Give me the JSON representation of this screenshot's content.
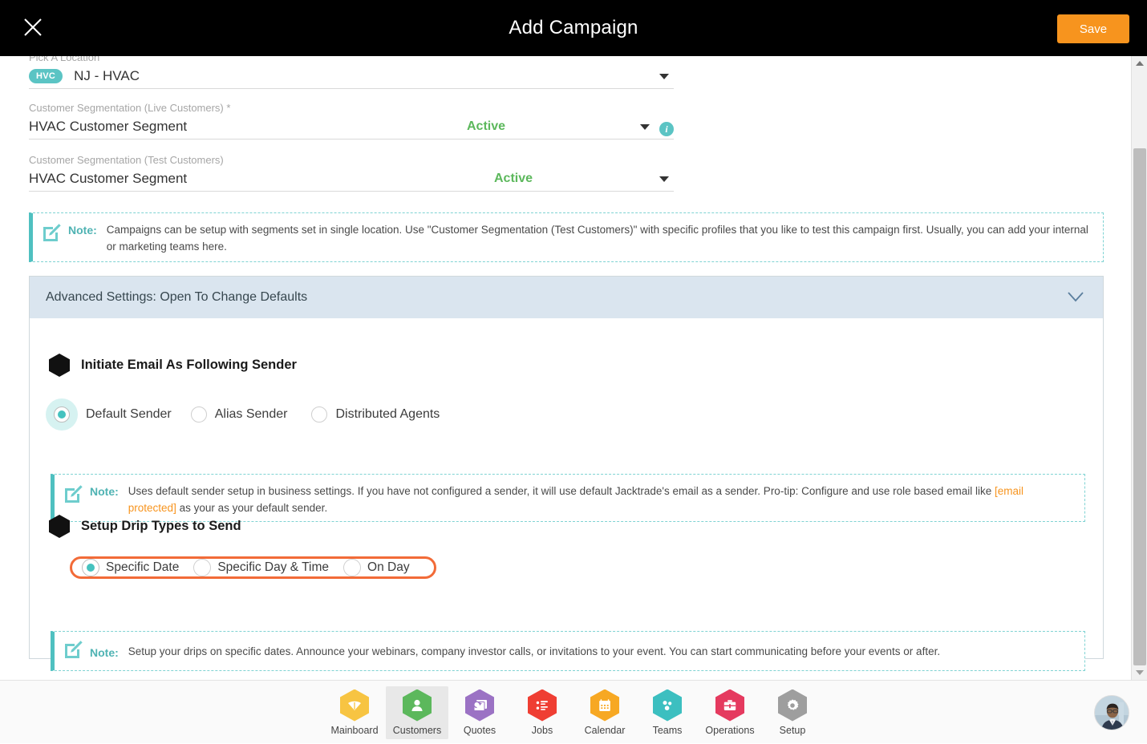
{
  "header": {
    "title": "Add Campaign",
    "close_icon": "close-icon",
    "save_label": "Save"
  },
  "form": {
    "location": {
      "label": "Pick A Location",
      "badge": "HVC",
      "value": "NJ - HVAC",
      "caret_icon": "chevron-down-icon"
    },
    "live_segmentation": {
      "label": "Customer Segmentation (Live Customers) *",
      "value": "HVAC Customer Segment",
      "status": "Active",
      "caret_icon": "chevron-down-icon",
      "info_icon": "info-icon",
      "info_glyph": "i"
    },
    "test_segmentation": {
      "label": "Customer Segmentation (Test Customers)",
      "value": "HVAC Customer Segment",
      "status": "Active",
      "caret_icon": "chevron-down-icon"
    }
  },
  "notes": {
    "label": "Note:",
    "icon": "edit-note-icon",
    "segmentation": "Campaigns can be setup with segments set in single location. Use \"Customer Segmentation (Test Customers)\" with specific profiles that you like to test this campaign first. Usually, you can add your internal or marketing teams here.",
    "sender_part1": "Uses default sender setup in business settings. If you have not configured a sender, it will use default Jacktrade's email as a sender. Pro-tip: Configure and use role based email like ",
    "sender_link": "[email protected]",
    "sender_part2": " as your as your default sender.",
    "drip": "Setup your drips on specific dates. Announce your webinars, company investor calls, or invitations to your event. You can start communicating before your events or after."
  },
  "advanced": {
    "header_title": "Advanced Settings: Open To Change Defaults",
    "chevron_icon": "chevron-down-icon",
    "sender_section": {
      "title": "Initiate Email As Following Sender",
      "bullet_icon": "hexagon-bullet-icon",
      "options": [
        {
          "label": "Default Sender",
          "selected": true
        },
        {
          "label": "Alias Sender",
          "selected": false
        },
        {
          "label": "Distributed Agents",
          "selected": false
        }
      ]
    },
    "drip_section": {
      "title": "Setup Drip Types to Send",
      "bullet_icon": "hexagon-bullet-icon",
      "options": [
        {
          "label": "Specific Date",
          "selected": true
        },
        {
          "label": "Specific Day & Time",
          "selected": false
        },
        {
          "label": "On Day",
          "selected": false
        }
      ]
    }
  },
  "scrollbar": {
    "up_icon": "scroll-up-arrow-icon",
    "down_icon": "scroll-down-arrow-icon"
  },
  "bottom_nav": {
    "items": [
      {
        "label": "Mainboard",
        "icon": "mainboard-icon",
        "color": "#f7c442",
        "active": false
      },
      {
        "label": "Customers",
        "icon": "customers-icon",
        "color": "#5cb85c",
        "active": true
      },
      {
        "label": "Quotes",
        "icon": "quotes-icon",
        "color": "#9b72c4",
        "active": false
      },
      {
        "label": "Jobs",
        "icon": "jobs-icon",
        "color": "#ef3e33",
        "active": false
      },
      {
        "label": "Calendar",
        "icon": "calendar-icon",
        "color": "#f7a823",
        "active": false
      },
      {
        "label": "Teams",
        "icon": "teams-icon",
        "color": "#3cbfc0",
        "active": false
      },
      {
        "label": "Operations",
        "icon": "operations-icon",
        "color": "#e53a5f",
        "active": false
      },
      {
        "label": "Setup",
        "icon": "setup-gear-icon",
        "color": "#9e9e9e",
        "active": false
      }
    ],
    "avatar_icon": "user-avatar"
  },
  "colors": {
    "accent_orange": "#f7941e",
    "teal": "#4fc0c0",
    "radio_teal": "#45c2bf",
    "focus_ring": "#f26b38",
    "active_green": "#5cb85c",
    "header_bg": "#000000",
    "panel_header_bg": "#dae5ef"
  }
}
